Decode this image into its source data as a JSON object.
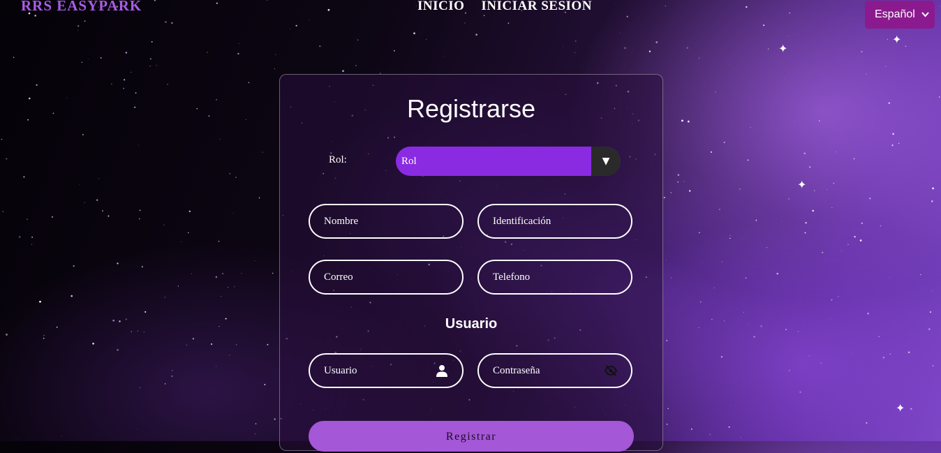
{
  "brand": "RRS EASYPARK",
  "nav": {
    "home": "INICIO",
    "login": "INICIAR SESION"
  },
  "language": {
    "selected": "Español"
  },
  "form": {
    "title": "Registrarse",
    "role_label": "Rol:",
    "role_value": "Rol",
    "name_placeholder": "Nombre",
    "id_placeholder": "Identificación",
    "email_placeholder": "Correo",
    "phone_placeholder": "Telefono",
    "user_section": "Usuario",
    "username_placeholder": "Usuario",
    "password_placeholder": "Contraseña",
    "submit_label": "Registrar"
  },
  "colors": {
    "brand": "#a95ce8",
    "select_bg": "#8a2be2",
    "language_bg": "#8b1a8f",
    "submit_bg": "#a457d6"
  },
  "icons": {
    "username": "user-icon",
    "password": "eye-slash-icon",
    "select": "caret-down-icon"
  }
}
